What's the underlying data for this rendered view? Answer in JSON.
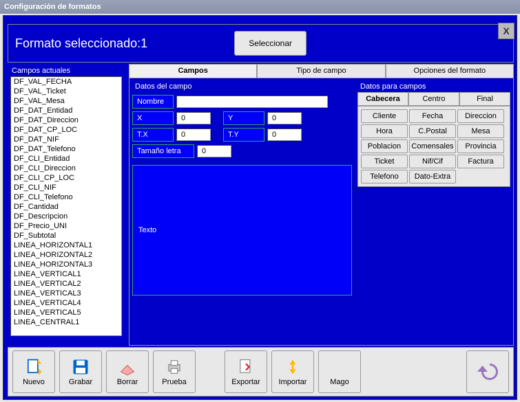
{
  "window": {
    "title": "Configuración de formatos"
  },
  "header": {
    "format_label": "Formato seleccionado:1",
    "select_button": "Seleccionar",
    "close": "X"
  },
  "left": {
    "title": "Campos actuales",
    "items": [
      "DF_VAL_FECHA",
      "DF_VAL_Ticket",
      "DF_VAL_Mesa",
      "DF_DAT_Entidad",
      "DF_DAT_Direccion",
      "DF_DAT_CP_LOC",
      "DF_DAT_NIF",
      "DF_DAT_Telefono",
      "DF_CLI_Entidad",
      "DF_CLI_Direccion",
      "DF_CLI_CP_LOC",
      "DF_CLI_NIF",
      "DF_CLI_Telefono",
      "DF_Cantidad",
      "DF_Descripcion",
      "DF_Precio_UNI",
      "DF_Subtotal",
      "LINEA_HORIZONTAL1",
      "LINEA_HORIZONTAL2",
      "LINEA_HORIZONTAL3",
      "LINEA_VERTICAL1",
      "LINEA_VERTICAL2",
      "LINEA_VERTICAL3",
      "LINEA_VERTICAL4",
      "LINEA_VERTICAL5",
      "LINEA_CENTRAL1"
    ]
  },
  "tabs": {
    "t1": "Campos",
    "t2": "Tipo de campo",
    "t3": "Opciones del formato"
  },
  "section1": {
    "title": "Datos del campo",
    "nombre_label": "Nombre",
    "nombre_value": "",
    "x_label": "X",
    "x_value": "0",
    "y_label": "Y",
    "y_value": "0",
    "tx_label": "T.X",
    "tx_value": "0",
    "ty_label": "T.Y",
    "ty_value": "0",
    "size_label": "Tamaño letra",
    "size_value": "0",
    "texto_label": "Texto"
  },
  "section2": {
    "title": "Datos para campos",
    "tabs": {
      "t1": "Cabecera",
      "t2": "Centro",
      "t3": "Final"
    },
    "buttons": [
      "Cliente",
      "Fecha",
      "Direccion",
      "Hora",
      "C.Postal",
      "Mesa",
      "Poblacion",
      "Comensales",
      "Provincia",
      "Ticket",
      "Nif/Cif",
      "Factura",
      "Telefono",
      "Dato-Extra"
    ]
  },
  "toolbar": {
    "nuevo": "Nuevo",
    "grabar": "Grabar",
    "borrar": "Borrar",
    "prueba": "Prueba",
    "exportar": "Exportar",
    "importar": "Importar",
    "mago": "Mago"
  }
}
